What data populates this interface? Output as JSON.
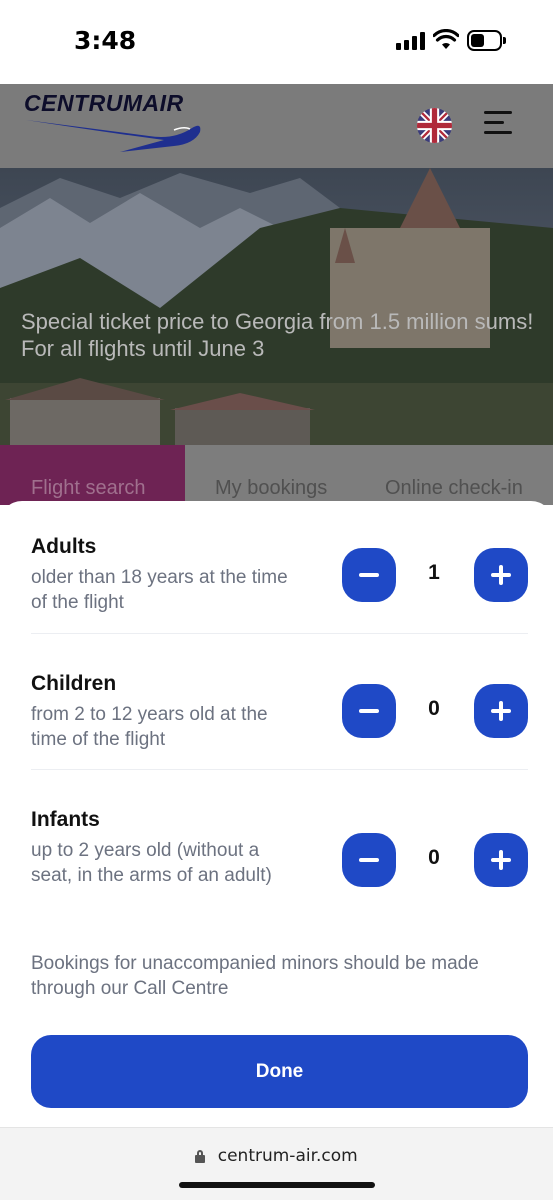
{
  "status_bar": {
    "time": "3:48"
  },
  "header": {
    "logo_text": "CENTRUMAIR",
    "flag": "uk-flag-icon",
    "menu": "hamburger-menu-icon"
  },
  "hero": {
    "promo_line1": "Special ticket price to Georgia from 1.5 million sums!",
    "promo_line2": "For all flights until June 3"
  },
  "tabs": [
    {
      "label": "Flight search",
      "active": true
    },
    {
      "label": "My bookings",
      "active": false
    },
    {
      "label": "Online check-in",
      "active": false
    }
  ],
  "passengers": {
    "adults": {
      "title": "Adults",
      "description": "older than 18 years at the time of the flight",
      "count": "1"
    },
    "children": {
      "title": "Children",
      "description": "from 2 to 12 years old at the time of the flight",
      "count": "0"
    },
    "infants": {
      "title": "Infants",
      "description": "up to 2 years old (without a seat, in the arms of an adult)",
      "count": "0"
    }
  },
  "notice": "Bookings for unaccompanied minors should be made through our Call Centre",
  "done_label": "Done",
  "browser": {
    "url": "centrum-air.com"
  },
  "colors": {
    "accent": "#1f49c6",
    "tab_active": "#6e2354"
  }
}
